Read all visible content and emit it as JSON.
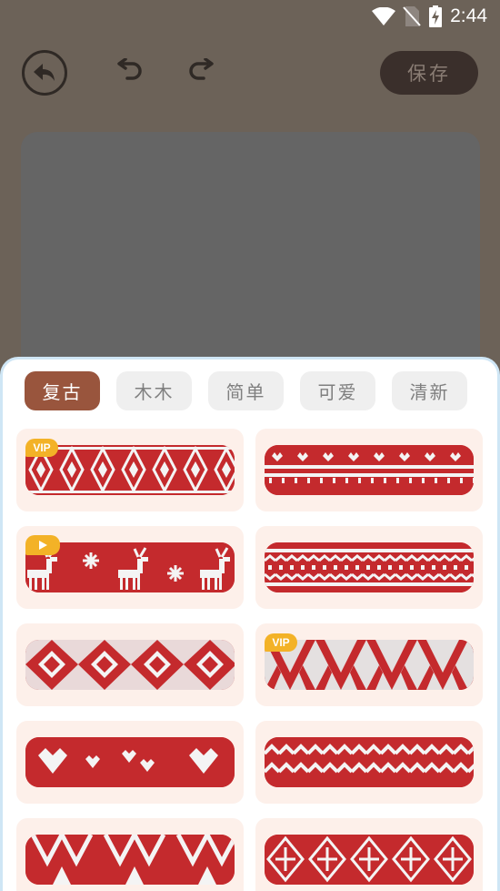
{
  "status_bar": {
    "time": "2:44",
    "icons": [
      "wifi-icon",
      "no-sim-icon",
      "battery-charging-icon"
    ]
  },
  "toolbar": {
    "save_label": "保存",
    "icons": [
      "back-arrow-icon",
      "undo-icon",
      "redo-icon"
    ]
  },
  "tabs": [
    {
      "label": "复古",
      "active": true
    },
    {
      "label": "木木",
      "active": false
    },
    {
      "label": "简单",
      "active": false
    },
    {
      "label": "可爱",
      "active": false
    },
    {
      "label": "清新",
      "active": false
    }
  ],
  "patterns": [
    {
      "name": "snowflake-band",
      "badge": "VIP"
    },
    {
      "name": "heart-band",
      "badge": ""
    },
    {
      "name": "reindeer-band",
      "badge": "video"
    },
    {
      "name": "border-stripes-band",
      "badge": ""
    },
    {
      "name": "diamond-band",
      "badge": ""
    },
    {
      "name": "zigzag-band",
      "badge": "VIP"
    },
    {
      "name": "hearts-knit-band",
      "badge": ""
    },
    {
      "name": "wave-band",
      "badge": ""
    },
    {
      "name": "triangle-band",
      "badge": ""
    },
    {
      "name": "star-diamond-band",
      "badge": ""
    }
  ],
  "colors": {
    "accent_tab": "#99553d",
    "knit_red": "#c42a2d",
    "knit_white": "#f4f4f4",
    "vip_badge": "#f3b227",
    "card_bg": "#fdf0ea"
  }
}
